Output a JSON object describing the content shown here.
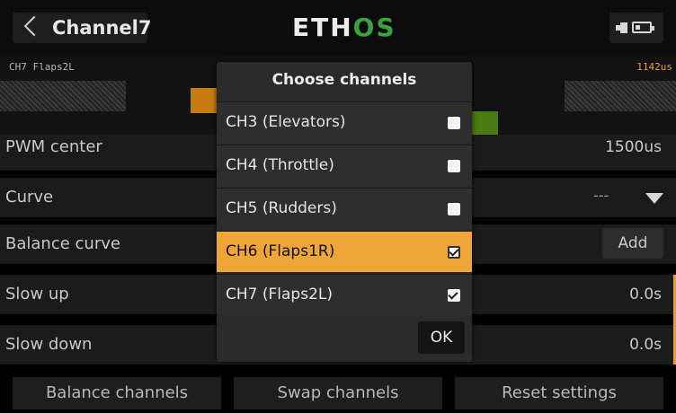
{
  "header": {
    "title": "Channel7",
    "logo_main": "ETH",
    "logo_accent": "OS",
    "back_icon": "chevron-left-icon",
    "status_icons": [
      "speaker-icon",
      "battery-icon"
    ]
  },
  "monitor": {
    "channel_label": "CH7  Flaps2L",
    "value": "1142us"
  },
  "settings": {
    "pwm_center": {
      "label": "PWM center",
      "value": "1500us"
    },
    "curve": {
      "label": "Curve",
      "value": "---"
    },
    "balance_curve": {
      "label": "Balance curve",
      "button": "Add"
    },
    "slow_up": {
      "label": "Slow up",
      "value": "0.0s"
    },
    "slow_down": {
      "label": "Slow down",
      "value": "0.0s"
    }
  },
  "bottom_buttons": {
    "balance": "Balance channels",
    "swap": "Swap channels",
    "reset": "Reset settings"
  },
  "dialog": {
    "title": "Choose channels",
    "options": [
      {
        "label": "CH3 (Elevators)",
        "checked": false,
        "selected": false
      },
      {
        "label": "CH4 (Throttle)",
        "checked": false,
        "selected": false
      },
      {
        "label": "CH5 (Rudders)",
        "checked": false,
        "selected": false
      },
      {
        "label": "CH6 (Flaps1R)",
        "checked": true,
        "selected": true
      },
      {
        "label": "CH7 (Flaps2L)",
        "checked": true,
        "selected": false
      }
    ],
    "ok_label": "OK"
  },
  "colors": {
    "accent": "#f0a636",
    "logo_green": "#3aa13c",
    "bar_orange": "#c77c12",
    "bar_green": "#4a7a12"
  }
}
